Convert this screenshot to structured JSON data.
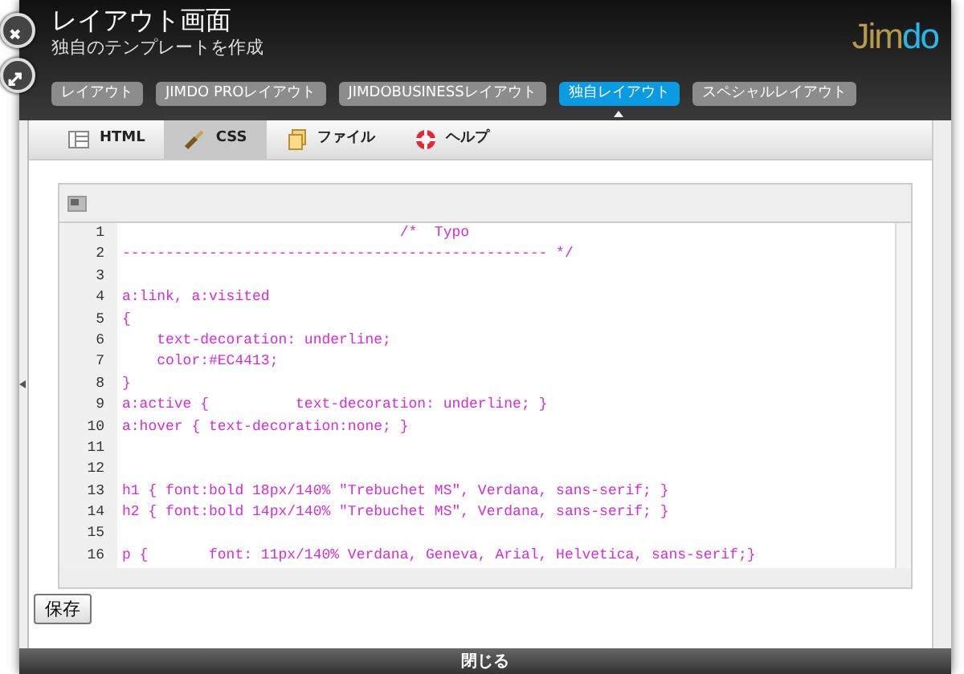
{
  "header": {
    "title": "レイアウト画面",
    "subtitle": "独自のテンプレートを作成",
    "logo_parts": [
      "Jim",
      "do"
    ]
  },
  "tabs": [
    {
      "label": "レイアウト",
      "selected": false
    },
    {
      "label": "JIMDO PROレイアウト",
      "selected": false
    },
    {
      "label": "JIMDOBUSINESSレイアウト",
      "selected": false
    },
    {
      "label": "独自レイアウト",
      "selected": true
    },
    {
      "label": "スペシャルレイアウト",
      "selected": false
    }
  ],
  "toolbar": [
    {
      "label": "HTML",
      "kind": "html",
      "selected": false
    },
    {
      "label": "CSS",
      "kind": "css",
      "selected": true
    },
    {
      "label": "ファイル",
      "kind": "file",
      "selected": false
    },
    {
      "label": "ヘルプ",
      "kind": "help",
      "selected": false
    }
  ],
  "editor": {
    "lines": [
      {
        "number": "1",
        "code": "                                /*  Typo"
      },
      {
        "number": "2",
        "code": "------------------------------------------------- */"
      },
      {
        "number": "3"
      },
      {
        "number": "4",
        "code": "a:link, a:visited"
      },
      {
        "number": "5",
        "code": "{"
      },
      {
        "number": "6",
        "code": "    text-decoration: underline;"
      },
      {
        "number": "7",
        "code": "    color:#EC4413;"
      },
      {
        "number": "8",
        "code": "}"
      },
      {
        "number": "9",
        "code": "a:active {          text-decoration: underline; }"
      },
      {
        "number": "10",
        "code": "a:hover { text-decoration:none; }"
      },
      {
        "number": "11"
      },
      {
        "number": "12"
      },
      {
        "number": "13",
        "code": "h1 { font:bold 18px/140% \"Trebuchet MS\", Verdana, sans-serif; }"
      },
      {
        "number": "14",
        "code": "h2 { font:bold 14px/140% \"Trebuchet MS\", Verdana, sans-serif; }"
      },
      {
        "number": "15"
      },
      {
        "number": "16",
        "code": "p {       font: 11px/140% Verdana, Geneva, Arial, Helvetica, sans-serif;}"
      }
    ]
  },
  "save_button": "保存",
  "footer": {
    "close_label": "閉じる"
  }
}
